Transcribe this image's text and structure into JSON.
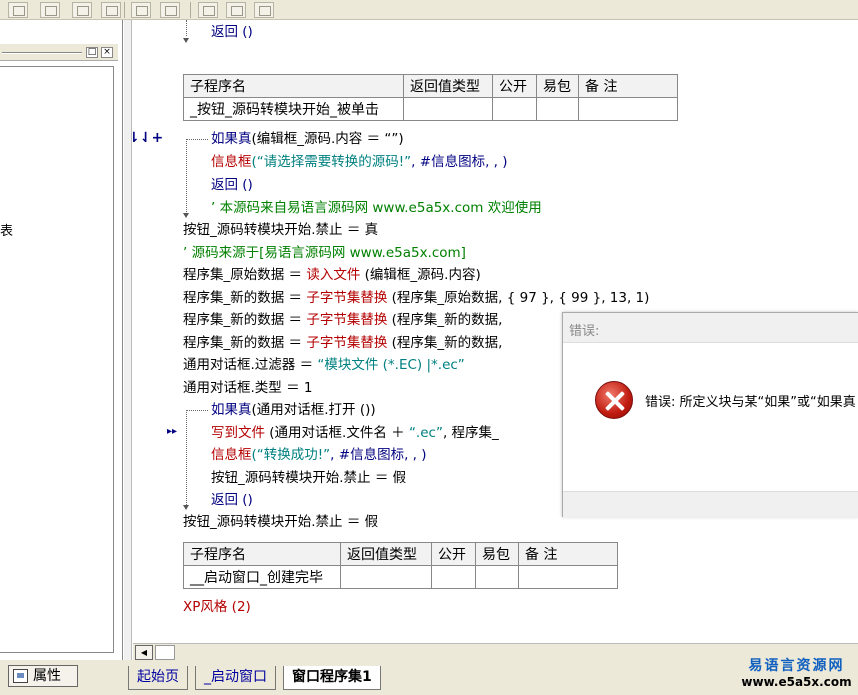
{
  "left_panel": {
    "stray_char": "表",
    "min_btn": "□",
    "close_btn": "×",
    "properties_tab": "属性"
  },
  "code": {
    "l_return_top": "返回 ()",
    "table1": {
      "headers": [
        "子程序名",
        "返回值类型",
        "公开",
        "易包",
        "备 注"
      ],
      "row": [
        "_按钮_源码转模块开始_被单击",
        "",
        "",
        "",
        ""
      ]
    },
    "line_if1_kw": "如果真",
    "line_if1_rest": "(编辑框_源码.内容 ＝ “”)",
    "line_msg1_fn": "信息框",
    "line_msg1_str": "(“请选择需要转换的源码!”",
    "line_msg1_rest": ", #信息图标, , )",
    "line_return1": "返回 ()",
    "line_comment1": "’ 本源码来自易语言源码网 www.e5a5x.com  欢迎使用",
    "line_disable1": "按钮_源码转模块开始.禁止 ＝ 真",
    "line_comment2": "’ 源码来源于[易语言源码网 www.e5a5x.com]",
    "line_read_a": "程序集_原始数据 ＝ ",
    "line_read_fn": "读入文件",
    "line_read_b": " (编辑框_源码.内容)",
    "line_rep1_a": "程序集_新的数据 ＝ ",
    "line_rep1_fn": "子字节集替换",
    "line_rep1_b": " (程序集_原始数据, { 97 }, { 99 }, 13, 1)",
    "line_rep2_a": "程序集_新的数据 ＝ ",
    "line_rep2_fn": "子字节集替换",
    "line_rep2_b": " (程序集_新的数据, ",
    "line_rep3_a": "程序集_新的数据 ＝ ",
    "line_rep3_fn": "子字节集替换",
    "line_rep3_b": " (程序集_新的数据, ",
    "line_filter_a": "通用对话框.过滤器 ＝ ",
    "line_filter_str": "“模块文件 (*.EC) |*.ec”",
    "line_type": "通用对话框.类型 ＝ 1",
    "line_if2_kw": "如果真",
    "line_if2_rest": "(通用对话框.打开 ())",
    "line_write_fn": "写到文件",
    "line_write_a": " (通用对话框.文件名 ＋ ",
    "line_write_str": "“.ec”",
    "line_write_b": ", 程序集_",
    "line_msg2_fn": "信息框",
    "line_msg2_str": "(“转换成功!”",
    "line_msg2_rest": ", #信息图标, , )",
    "line_enable_inner": "按钮_源码转模块开始.禁止 ＝ 假",
    "line_return2": "返回 ()",
    "line_enable_outer": "按钮_源码转模块开始.禁止 ＝ 假",
    "table2": {
      "headers": [
        "子程序名",
        "返回值类型",
        "公开",
        "易包",
        "备 注"
      ],
      "row": [
        "__启动窗口_创建完毕",
        "",
        "",
        "",
        ""
      ]
    },
    "line_xp": "XP风格 (2)",
    "marker1": "⇂⇃+",
    "marker2": "▸▸"
  },
  "tabs": [
    "起始页",
    "_启动窗口",
    "窗口程序集1"
  ],
  "dialog": {
    "title": "错误:",
    "message": "错误: 所定义块与某“如果”或“如果真"
  },
  "watermark": {
    "line1": "易语言资源网",
    "line2": "www.e5a5x.com"
  },
  "colors": {
    "keyword": "#000080",
    "function": "#b40000",
    "string": "#008080",
    "comment": "#008000"
  }
}
